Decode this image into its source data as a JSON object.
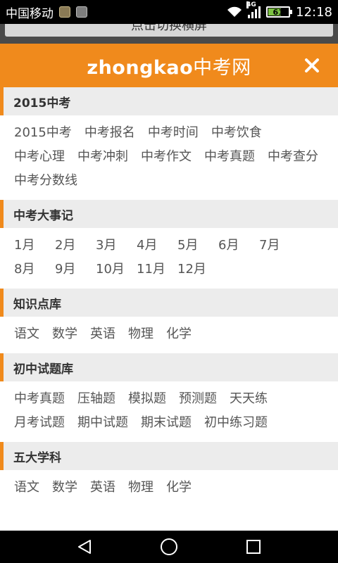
{
  "status_bar": {
    "carrier": "中国移动",
    "network": "4G",
    "battery": "61",
    "battery_level": 0.61,
    "time": "12:18"
  },
  "switch_button": {
    "label": "点击切换横屏"
  },
  "header": {
    "logo_en": "zhongkao",
    "logo_cn": "中考网",
    "brand_color": "#f08a1c",
    "close_icon": "close-icon"
  },
  "sections": [
    {
      "title": "2015中考",
      "links": [
        "2015中考",
        "中考报名",
        "中考时间",
        "中考饮食",
        "中考心理",
        "中考冲刺",
        "中考作文",
        "中考真题",
        "中考查分",
        "中考分数线"
      ]
    },
    {
      "title": "中考大事记",
      "links": [
        "1月",
        "2月",
        "3月",
        "4月",
        "5月",
        "6月",
        "7月",
        "8月",
        "9月",
        "10月",
        "11月",
        "12月"
      ]
    },
    {
      "title": "知识点库",
      "links": [
        "语文",
        "数学",
        "英语",
        "物理",
        "化学"
      ]
    },
    {
      "title": "初中试题库",
      "links": [
        "中考真题",
        "压轴题",
        "模拟题",
        "预测题",
        "天天练",
        "月考试题",
        "期中试题",
        "期末试题",
        "初中练习题"
      ]
    },
    {
      "title": "五大学科",
      "links": [
        "语文",
        "数学",
        "英语",
        "物理",
        "化学"
      ]
    }
  ],
  "nav_bar": {
    "back_icon": "back-triangle-icon",
    "home_icon": "home-circle-icon",
    "recents_icon": "recents-square-icon"
  }
}
